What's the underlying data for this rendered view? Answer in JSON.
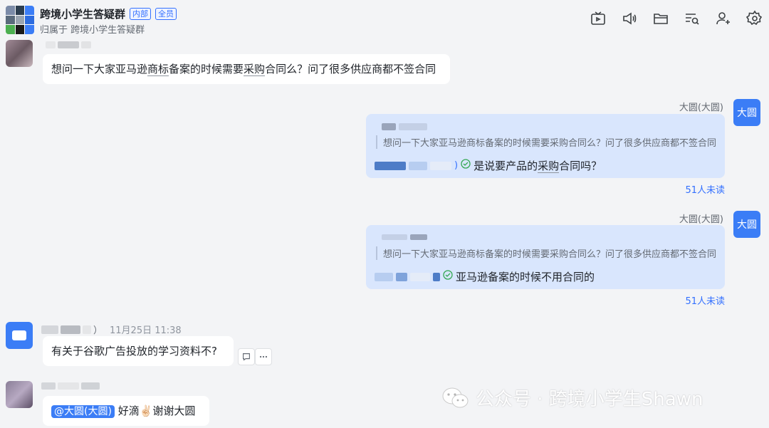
{
  "header": {
    "title": "跨境小学生答疑群",
    "tag_internal": "内部",
    "tag_all": "全员",
    "subtitle": "归属于 跨境小学生答疑群"
  },
  "toolbar": {
    "icons": [
      "tv-icon",
      "speaker-icon",
      "folder-icon",
      "search-list-icon",
      "add-user-icon",
      "settings-icon"
    ]
  },
  "messages": {
    "m1": {
      "text_a": "想问一下大家亚马逊",
      "text_b": "商标",
      "text_c": "备案的时候需要",
      "text_d": "采购",
      "text_e": "合同么？问了很多供应商都不签合同"
    },
    "m2": {
      "sender": "大圆(大圆)",
      "avatar_label": "大圆",
      "quote": "想问一下大家亚马逊商标备案的时候需要采购合同么？问了很多供应商都不签合同",
      "suffix": ")",
      "reply_a": "是说要产品的",
      "reply_b": "采购",
      "reply_c": "合同吗？",
      "unread": "51人未读"
    },
    "m3": {
      "sender": "大圆(大圆)",
      "avatar_label": "大圆",
      "quote": "想问一下大家亚马逊商标备案的时候需要采购合同么？问了很多供应商都不签合同",
      "reply": "亚马逊备案的时候不用合同的",
      "unread": "51人未读"
    },
    "m4": {
      "name_suffix": "）",
      "time": "11月25日 11:38",
      "text": "有关于谷歌广告投放的学习资料不?"
    },
    "m5": {
      "mention": "@大圆(大圆)",
      "text_a": "好滴",
      "emoji": "✌🏻",
      "text_b": "谢谢大圆"
    }
  },
  "watermark": {
    "text": "公众号 · 跨境小学生Shawn"
  },
  "colors": {
    "accent": "#3370ff",
    "self_bubble": "#d9e6fd",
    "background": "#f3f4f6"
  }
}
